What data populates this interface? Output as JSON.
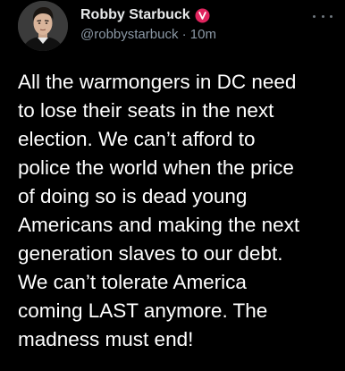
{
  "tweet": {
    "display_name": "Robby Starbuck",
    "verified_icon": "verified-badge-icon",
    "verified_color": "#e0245e",
    "handle": "@robbystarbuck",
    "separator": "·",
    "time": "10m",
    "more_icon": "more-options-icon",
    "text": "All the warmongers in DC need\nto lose their seats in the next\nelection. We can’t afford to\npolice the world when the price\nof doing so is dead young\nAmericans and making the next\ngeneration slaves to our debt.\nWe can’t tolerate America\ncoming LAST anymore. The\nmadness must end!"
  },
  "colors": {
    "background": "#000000",
    "text_primary": "#ffffff",
    "text_secondary": "#8b98a5"
  }
}
